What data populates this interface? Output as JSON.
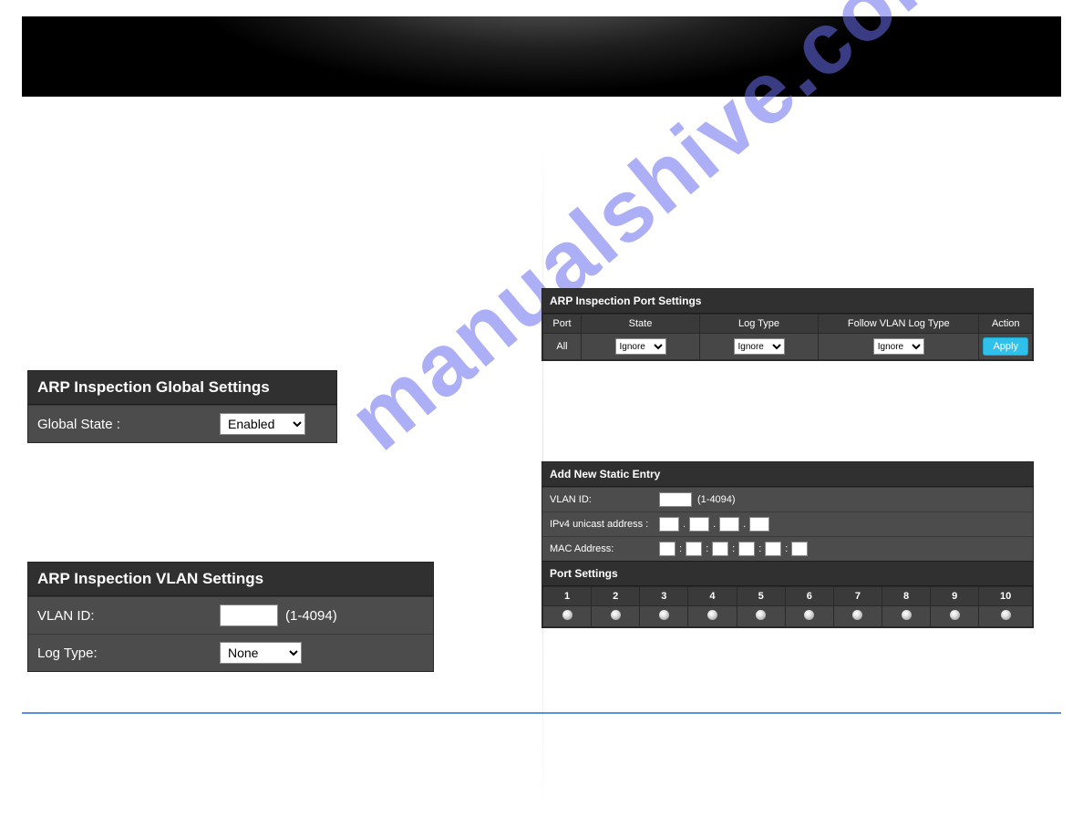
{
  "overview": {
    "link_text": "                                                                        "
  },
  "left": {
    "global_panel": {
      "title": "ARP Inspection Global Settings",
      "state_label": "Global State :",
      "state_value": "Enabled"
    },
    "vlan_panel": {
      "title": "ARP Inspection VLAN Settings",
      "vlan_label": "VLAN ID:",
      "vlan_range": "(1-4094)",
      "logtype_label": "Log Type:",
      "logtype_value": "None"
    }
  },
  "right": {
    "port_settings": {
      "title": "ARP Inspection Port Settings",
      "columns": {
        "c1": "Port",
        "c2": "State",
        "c3": "Log Type",
        "c4": "Follow VLAN Log Type",
        "c5": "Action"
      },
      "row": {
        "port": "All",
        "state": "Ignore",
        "logtype": "Ignore",
        "follow": "Ignore",
        "apply": "Apply"
      }
    },
    "static_entry": {
      "title": "Add New Static Entry",
      "vlan_label": "VLAN ID:",
      "vlan_range": "(1-4094)",
      "ipv4_label": "IPv4 unicast address :",
      "mac_label": "MAC Address:",
      "ports_title": "Port Settings",
      "ports": [
        "1",
        "2",
        "3",
        "4",
        "5",
        "6",
        "7",
        "8",
        "9",
        "10"
      ]
    }
  },
  "sep": {
    "dot": ".",
    "colon": ":"
  }
}
